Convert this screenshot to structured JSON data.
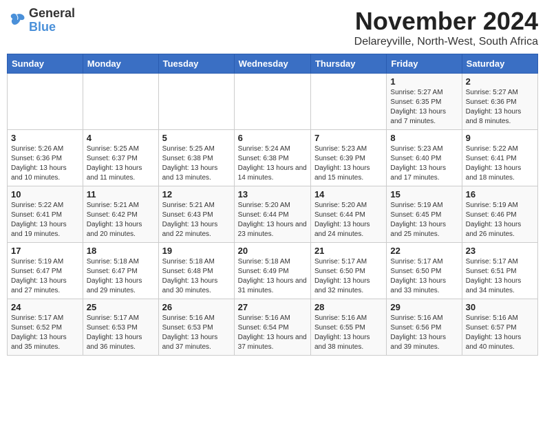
{
  "logo": {
    "general": "General",
    "blue": "Blue"
  },
  "title": {
    "month_year": "November 2024",
    "location": "Delareyville, North-West, South Africa"
  },
  "days_of_week": [
    "Sunday",
    "Monday",
    "Tuesday",
    "Wednesday",
    "Thursday",
    "Friday",
    "Saturday"
  ],
  "weeks": [
    [
      {
        "day": "",
        "info": ""
      },
      {
        "day": "",
        "info": ""
      },
      {
        "day": "",
        "info": ""
      },
      {
        "day": "",
        "info": ""
      },
      {
        "day": "",
        "info": ""
      },
      {
        "day": "1",
        "info": "Sunrise: 5:27 AM\nSunset: 6:35 PM\nDaylight: 13 hours and 7 minutes."
      },
      {
        "day": "2",
        "info": "Sunrise: 5:27 AM\nSunset: 6:36 PM\nDaylight: 13 hours and 8 minutes."
      }
    ],
    [
      {
        "day": "3",
        "info": "Sunrise: 5:26 AM\nSunset: 6:36 PM\nDaylight: 13 hours and 10 minutes."
      },
      {
        "day": "4",
        "info": "Sunrise: 5:25 AM\nSunset: 6:37 PM\nDaylight: 13 hours and 11 minutes."
      },
      {
        "day": "5",
        "info": "Sunrise: 5:25 AM\nSunset: 6:38 PM\nDaylight: 13 hours and 13 minutes."
      },
      {
        "day": "6",
        "info": "Sunrise: 5:24 AM\nSunset: 6:38 PM\nDaylight: 13 hours and 14 minutes."
      },
      {
        "day": "7",
        "info": "Sunrise: 5:23 AM\nSunset: 6:39 PM\nDaylight: 13 hours and 15 minutes."
      },
      {
        "day": "8",
        "info": "Sunrise: 5:23 AM\nSunset: 6:40 PM\nDaylight: 13 hours and 17 minutes."
      },
      {
        "day": "9",
        "info": "Sunrise: 5:22 AM\nSunset: 6:41 PM\nDaylight: 13 hours and 18 minutes."
      }
    ],
    [
      {
        "day": "10",
        "info": "Sunrise: 5:22 AM\nSunset: 6:41 PM\nDaylight: 13 hours and 19 minutes."
      },
      {
        "day": "11",
        "info": "Sunrise: 5:21 AM\nSunset: 6:42 PM\nDaylight: 13 hours and 20 minutes."
      },
      {
        "day": "12",
        "info": "Sunrise: 5:21 AM\nSunset: 6:43 PM\nDaylight: 13 hours and 22 minutes."
      },
      {
        "day": "13",
        "info": "Sunrise: 5:20 AM\nSunset: 6:44 PM\nDaylight: 13 hours and 23 minutes."
      },
      {
        "day": "14",
        "info": "Sunrise: 5:20 AM\nSunset: 6:44 PM\nDaylight: 13 hours and 24 minutes."
      },
      {
        "day": "15",
        "info": "Sunrise: 5:19 AM\nSunset: 6:45 PM\nDaylight: 13 hours and 25 minutes."
      },
      {
        "day": "16",
        "info": "Sunrise: 5:19 AM\nSunset: 6:46 PM\nDaylight: 13 hours and 26 minutes."
      }
    ],
    [
      {
        "day": "17",
        "info": "Sunrise: 5:19 AM\nSunset: 6:47 PM\nDaylight: 13 hours and 27 minutes."
      },
      {
        "day": "18",
        "info": "Sunrise: 5:18 AM\nSunset: 6:47 PM\nDaylight: 13 hours and 29 minutes."
      },
      {
        "day": "19",
        "info": "Sunrise: 5:18 AM\nSunset: 6:48 PM\nDaylight: 13 hours and 30 minutes."
      },
      {
        "day": "20",
        "info": "Sunrise: 5:18 AM\nSunset: 6:49 PM\nDaylight: 13 hours and 31 minutes."
      },
      {
        "day": "21",
        "info": "Sunrise: 5:17 AM\nSunset: 6:50 PM\nDaylight: 13 hours and 32 minutes."
      },
      {
        "day": "22",
        "info": "Sunrise: 5:17 AM\nSunset: 6:50 PM\nDaylight: 13 hours and 33 minutes."
      },
      {
        "day": "23",
        "info": "Sunrise: 5:17 AM\nSunset: 6:51 PM\nDaylight: 13 hours and 34 minutes."
      }
    ],
    [
      {
        "day": "24",
        "info": "Sunrise: 5:17 AM\nSunset: 6:52 PM\nDaylight: 13 hours and 35 minutes."
      },
      {
        "day": "25",
        "info": "Sunrise: 5:17 AM\nSunset: 6:53 PM\nDaylight: 13 hours and 36 minutes."
      },
      {
        "day": "26",
        "info": "Sunrise: 5:16 AM\nSunset: 6:53 PM\nDaylight: 13 hours and 37 minutes."
      },
      {
        "day": "27",
        "info": "Sunrise: 5:16 AM\nSunset: 6:54 PM\nDaylight: 13 hours and 37 minutes."
      },
      {
        "day": "28",
        "info": "Sunrise: 5:16 AM\nSunset: 6:55 PM\nDaylight: 13 hours and 38 minutes."
      },
      {
        "day": "29",
        "info": "Sunrise: 5:16 AM\nSunset: 6:56 PM\nDaylight: 13 hours and 39 minutes."
      },
      {
        "day": "30",
        "info": "Sunrise: 5:16 AM\nSunset: 6:57 PM\nDaylight: 13 hours and 40 minutes."
      }
    ]
  ]
}
